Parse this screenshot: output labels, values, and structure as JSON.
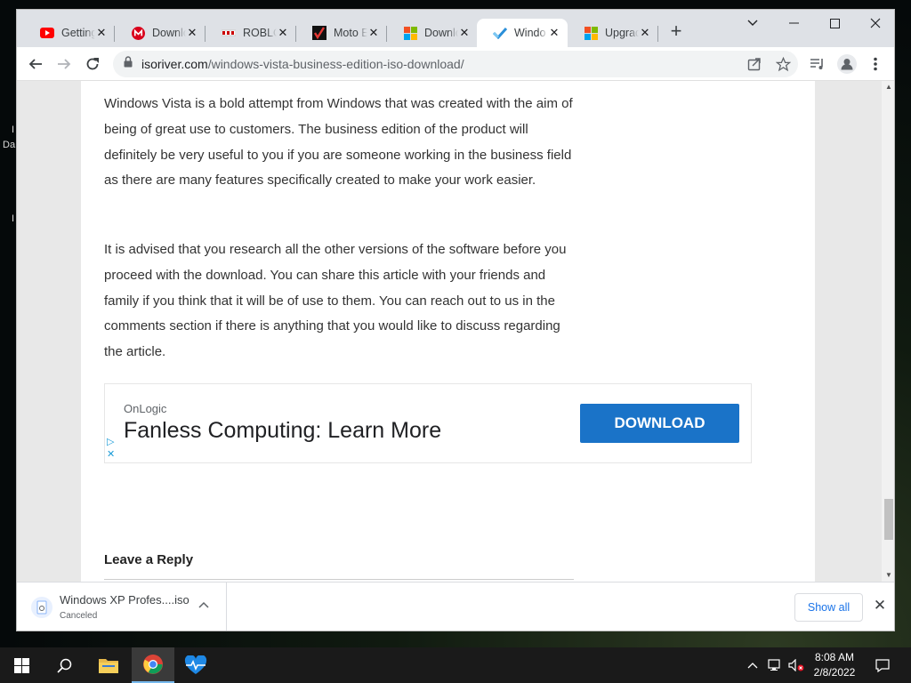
{
  "desktop": {
    "glyphs": [
      "I",
      "Da",
      "I"
    ]
  },
  "tabs": [
    {
      "title": "Getting",
      "favicon": "youtube-icon",
      "color": "#ff0000"
    },
    {
      "title": "Downlo",
      "favicon": "red-circle-m-icon",
      "color": "#d9001b"
    },
    {
      "title": "ROBLOX",
      "favicon": "roblox-icon",
      "color": "#c00000"
    },
    {
      "title": "Moto E",
      "favicon": "checkmark-icon",
      "color": "#b71c1c"
    },
    {
      "title": "Downlo",
      "favicon": "windows-icon",
      "color": "#f25022"
    },
    {
      "title": "Windo",
      "favicon": "blue-check-icon",
      "color": "#2a8fd9"
    },
    {
      "title": "Upgrad",
      "favicon": "windows-icon",
      "color": "#f25022"
    }
  ],
  "tab_close_glyph": "✕",
  "new_tab_glyph": "+",
  "window_controls": {
    "chevron": "⌄",
    "minimize": "—",
    "maximize": "☐",
    "close": "✕"
  },
  "toolbar": {
    "url_host": "isoriver.com",
    "url_path": "/windows-vista-business-edition-iso-download/"
  },
  "article": {
    "paragraphs": [
      "Windows Vista is a bold attempt from Windows that was created with the aim of being of great use to customers. The business edition of the product will definitely be very useful to you if you are someone working in the business field as there are many features specifically created to make your work easier.",
      "It is advised that you research all the other versions of the software before you proceed with the download. You can share this article with your friends and family if you think that it will be of use to them. You can reach out to us in the comments section if there is anything that you would like to discuss regarding the article."
    ],
    "reply_heading": "Leave a Reply"
  },
  "ad": {
    "advertiser": "OnLogic",
    "headline": "Fanless Computing: Learn More",
    "cta": "DOWNLOAD",
    "adchoices_play": "▷",
    "adchoices_close": "✕"
  },
  "download_shelf": {
    "filename": "Windows XP Profes....iso",
    "status": "Canceled",
    "caret": "^",
    "show_all": "Show all",
    "close": "✕"
  },
  "taskbar": {
    "time": "8:08 AM",
    "date": "2/8/2022"
  },
  "colors": {
    "accent": "#1a73c8",
    "link": "#1a73e8",
    "tab_bg": "#dee1e6"
  }
}
